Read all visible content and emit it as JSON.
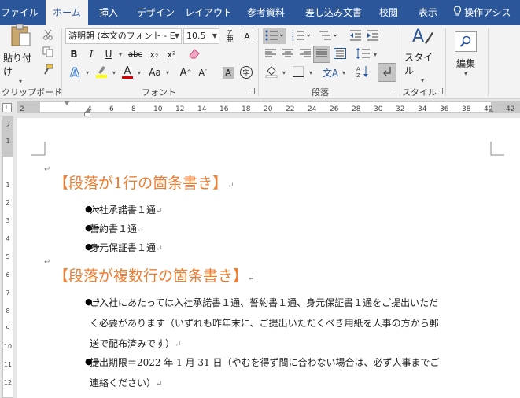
{
  "tabs": [
    {
      "label": "ファイル"
    },
    {
      "label": "ホーム"
    },
    {
      "label": "挿入"
    },
    {
      "label": "デザイン"
    },
    {
      "label": "レイアウト"
    },
    {
      "label": "参考資料"
    },
    {
      "label": "差し込み文書"
    },
    {
      "label": "校閲"
    },
    {
      "label": "表示"
    },
    {
      "label": "操作アシス"
    }
  ],
  "ribbon": {
    "clipboard": {
      "paste_label": "貼り付け",
      "group_label": "クリップボード"
    },
    "font": {
      "font_name": "游明朝 (本文のフォント - E",
      "font_size": "10.5",
      "aa_label": "Aa",
      "group_label": "フォント",
      "bold": "B",
      "italic": "I",
      "underline": "U",
      "strike": "abc",
      "sub": "x₂",
      "sup": "x²",
      "grow": "A",
      "shrink": "A",
      "clear": "A",
      "ruby": "亜",
      "enclose": "字",
      "phonetic": "A"
    },
    "paragraph": {
      "group_label": "段落"
    },
    "styles": {
      "style_label": "スタイル",
      "group_label": "スタイル"
    },
    "editing": {
      "edit_label": "編集"
    }
  },
  "colors": {
    "tabbar": "#2b579a",
    "heading": "#ed7d31",
    "highlight": "#ffff00",
    "font_color": "#e00000"
  },
  "ruler": {
    "numbers": [
      "2",
      "2",
      "4",
      "6",
      "8",
      "10",
      "12",
      "14",
      "16",
      "18",
      "20",
      "22",
      "24",
      "26",
      "28",
      "30",
      "32",
      "34",
      "36",
      "38",
      "40",
      "42"
    ]
  },
  "vruler": {
    "numbers": [
      "2",
      "1",
      "1",
      "2",
      "3",
      "4",
      "5",
      "6",
      "7",
      "8",
      "9",
      "10",
      "11",
      "12"
    ]
  },
  "document": {
    "heading1": "【段落が1行の箇条書き】",
    "list1": [
      "入社承諾書１通",
      "誓約書１通",
      "身元保証書１通"
    ],
    "heading2": "【段落が複数行の箇条書き】",
    "para1_lines": [
      "ご入社にあたっては入社承諾書１通、誓約書１通、身元保証書１通をご提出いただ",
      "く必要があります（いずれも昨年末に、ご提出いただくべき用紙を人事の方から郵",
      "送で配布済みです）"
    ],
    "para2_lines": [
      "提出期限＝2022 年 1 月 31 日（やむを得ず間に合わない場合は、必ず人事までご",
      "連絡ください）"
    ],
    "bullet_char": "●",
    "arrow_char": "→",
    "return_mark": "↵"
  }
}
